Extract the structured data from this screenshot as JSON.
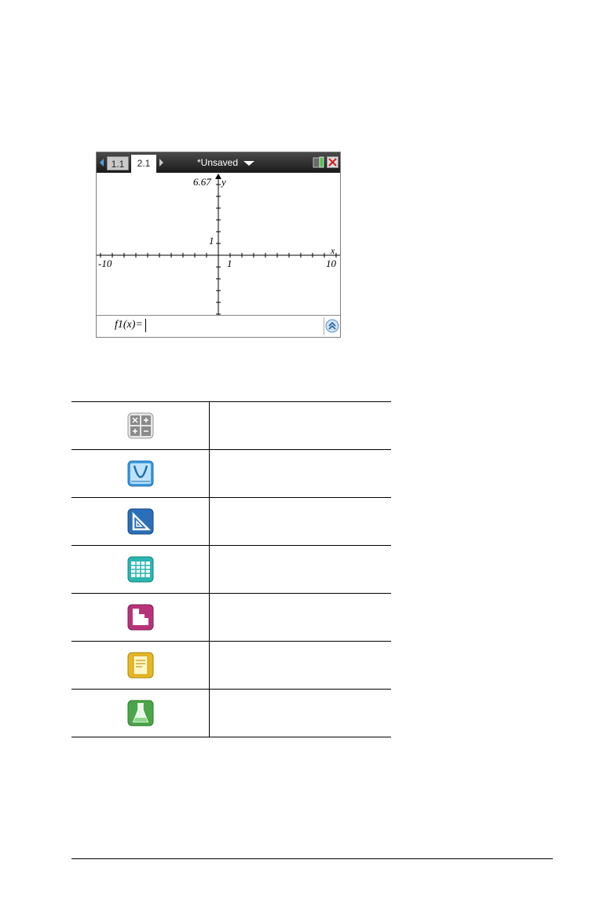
{
  "screen": {
    "tabs": [
      {
        "label": "1.1"
      },
      {
        "label": "2.1"
      }
    ],
    "active_tab": "2.1",
    "document_title": "*Unsaved",
    "graph": {
      "y_max_label": "6.67",
      "y_axis_label": "y",
      "y_tick_label": "1",
      "x_axis_label": "x",
      "x_min_label": "-10",
      "x_tick_label": "1",
      "x_max_label": "10"
    },
    "entry_line": {
      "label": "f1(x)="
    }
  },
  "icons": [
    {
      "name": "calculator-app-icon",
      "color": "#8a8a8a"
    },
    {
      "name": "graphs-app-icon",
      "color": "#3a9be0"
    },
    {
      "name": "geometry-app-icon",
      "color": "#2a6fb8"
    },
    {
      "name": "lists-spreadsheet-app-icon",
      "color": "#2bb5b0"
    },
    {
      "name": "data-statistics-app-icon",
      "color": "#b8327a"
    },
    {
      "name": "notes-app-icon",
      "color": "#e8b820"
    },
    {
      "name": "vernier-dataquest-app-icon",
      "color": "#4aa648"
    }
  ]
}
